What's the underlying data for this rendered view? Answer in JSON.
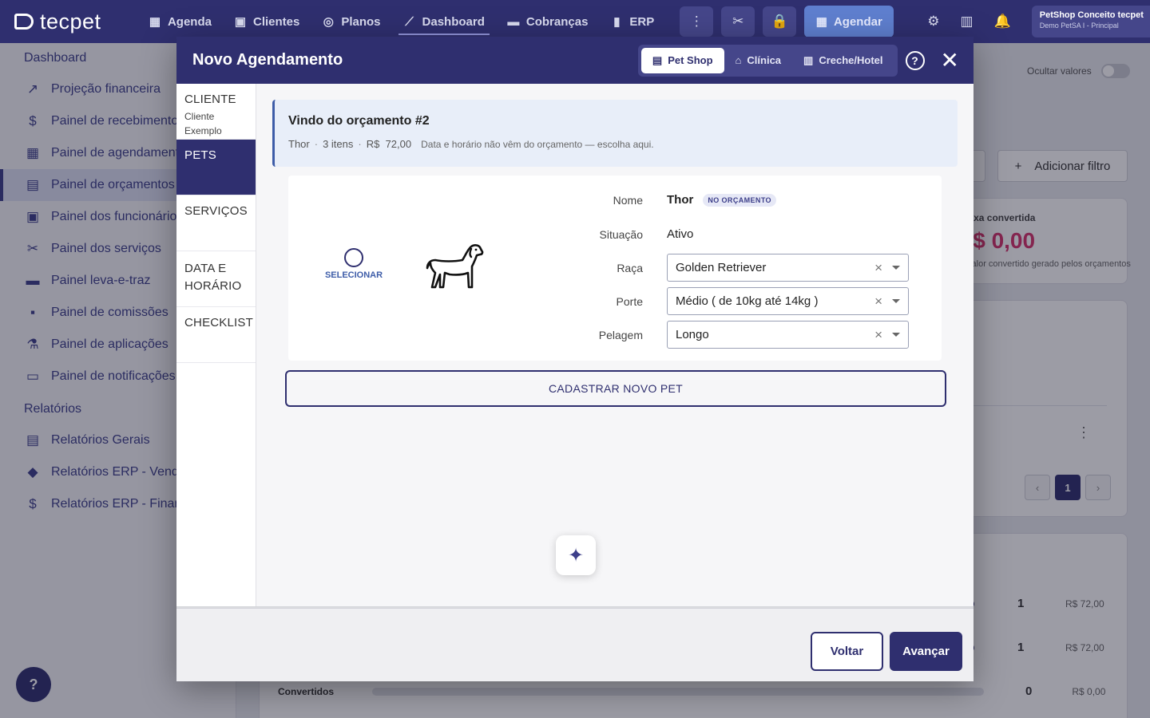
{
  "topbar": {
    "logo_text": "tecpet",
    "nav": [
      {
        "label": "Agenda",
        "icon": "calendar-icon"
      },
      {
        "label": "Clientes",
        "icon": "people-icon"
      },
      {
        "label": "Planos",
        "icon": "badge-icon"
      },
      {
        "label": "Dashboard",
        "icon": "chart-line-icon",
        "active": true
      },
      {
        "label": "Cobranças",
        "icon": "money-icon"
      },
      {
        "label": "ERP",
        "icon": "bar-chart-icon"
      }
    ],
    "tools": {
      "more": "⋮",
      "scissors": "✂",
      "lock": "🔒"
    },
    "agendar_label": "Agendar",
    "account": {
      "name": "PetShop Conceito tecpet",
      "subtitle": "Demo PetSA I - Principal"
    }
  },
  "sidebar": {
    "sections": [
      {
        "title": "Dashboard",
        "items": [
          {
            "label": "Projeção financeira",
            "icon": "trend-icon"
          },
          {
            "label": "Painel de recebimentos",
            "icon": "dollar-circle-icon"
          },
          {
            "label": "Painel de agendamentos",
            "icon": "calendar-icon"
          },
          {
            "label": "Painel de orçamentos",
            "icon": "invoice-icon",
            "active": true
          },
          {
            "label": "Painel dos funcionários",
            "icon": "staff-icon"
          },
          {
            "label": "Painel dos serviços",
            "icon": "scissors-icon"
          },
          {
            "label": "Painel leva-e-traz",
            "icon": "truck-icon"
          },
          {
            "label": "Painel de comissões",
            "icon": "cash-icon"
          },
          {
            "label": "Painel de aplicações",
            "icon": "syringe-icon"
          },
          {
            "label": "Painel de notificações",
            "icon": "chat-icon"
          }
        ]
      },
      {
        "title": "Relatórios",
        "items": [
          {
            "label": "Relatórios Gerais",
            "icon": "clipboard-icon"
          },
          {
            "label": "Relatórios ERP - Vendas",
            "icon": "tag-icon"
          },
          {
            "label": "Relatórios ERP - Financeiro",
            "icon": "dollar-circle-icon"
          }
        ]
      }
    ]
  },
  "background": {
    "ocultar_label": "Ocultar valores",
    "filter_label": "Adicionar filtro",
    "conv_label": "Taxa convertida",
    "conv_value": "R$ 0,00",
    "conv_note": "Valor convertido gerado pelos orçamentos",
    "page": "1",
    "rows": [
      {
        "count": "1",
        "value": "R$ 72,00"
      },
      {
        "count": "1",
        "value": "R$ 72,00"
      }
    ],
    "bottom_row": {
      "label": "Convertidos",
      "count": "0",
      "value": "R$ 0,00"
    }
  },
  "modal": {
    "title": "Novo Agendamento",
    "segments": [
      {
        "label": "Pet Shop",
        "icon": "store-icon",
        "active": true
      },
      {
        "label": "Clínica",
        "icon": "clinic-icon"
      },
      {
        "label": "Creche/Hotel",
        "icon": "hotel-icon"
      }
    ],
    "steps": [
      {
        "title": "CLIENTE",
        "value": "Cliente Exemplo"
      },
      {
        "title": "PETS",
        "value": "",
        "active": true
      },
      {
        "title": "SERVIÇOS",
        "value": ""
      },
      {
        "title": "DATA E HORÁRIO",
        "value": ""
      },
      {
        "title": "CHECKLIST",
        "value": ""
      }
    ],
    "origin": {
      "title": "Vindo do orçamento #2",
      "pet": "Thor",
      "items": "3 itens",
      "total": "R$  72,00",
      "note": "Data e horário não vêm do orçamento — escolha aqui."
    },
    "pet": {
      "select_label": "SELECIONAR",
      "fields": {
        "nome": {
          "label": "Nome",
          "value": "Thor",
          "badge": "NO ORÇAMENTO"
        },
        "situacao": {
          "label": "Situação",
          "value": "Ativo"
        },
        "raca": {
          "label": "Raça",
          "value": "Golden Retriever"
        },
        "porte": {
          "label": "Porte",
          "value": "Médio ( de 10kg até 14kg )"
        },
        "pelagem": {
          "label": "Pelagem",
          "value": "Longo"
        }
      }
    },
    "new_pet_label": "CADASTRAR NOVO PET",
    "footer": {
      "back_label": "Voltar",
      "next_label": "Avançar"
    }
  }
}
